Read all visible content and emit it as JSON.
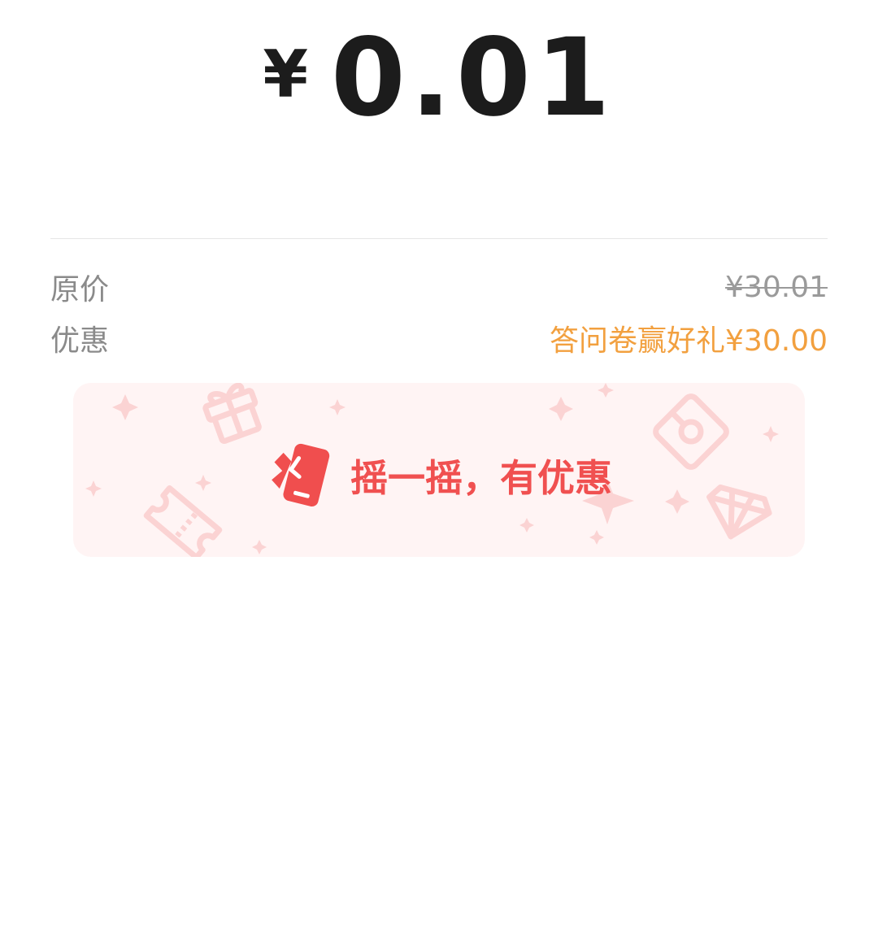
{
  "payment": {
    "currency_symbol": "¥",
    "amount": "0.01"
  },
  "details": {
    "original_label": "原价",
    "original_value": "¥30.01",
    "discount_label": "优惠",
    "discount_value": "答问卷赢好礼¥30.00"
  },
  "banner": {
    "text": "摇一摇，有优惠",
    "icon": "shake-phone-icon"
  },
  "colors": {
    "amount": "#1c1c1c",
    "label": "#8a8a8a",
    "promo": "#f2a03f",
    "banner_bg": "#fff4f4",
    "banner_accent": "#f05050"
  }
}
